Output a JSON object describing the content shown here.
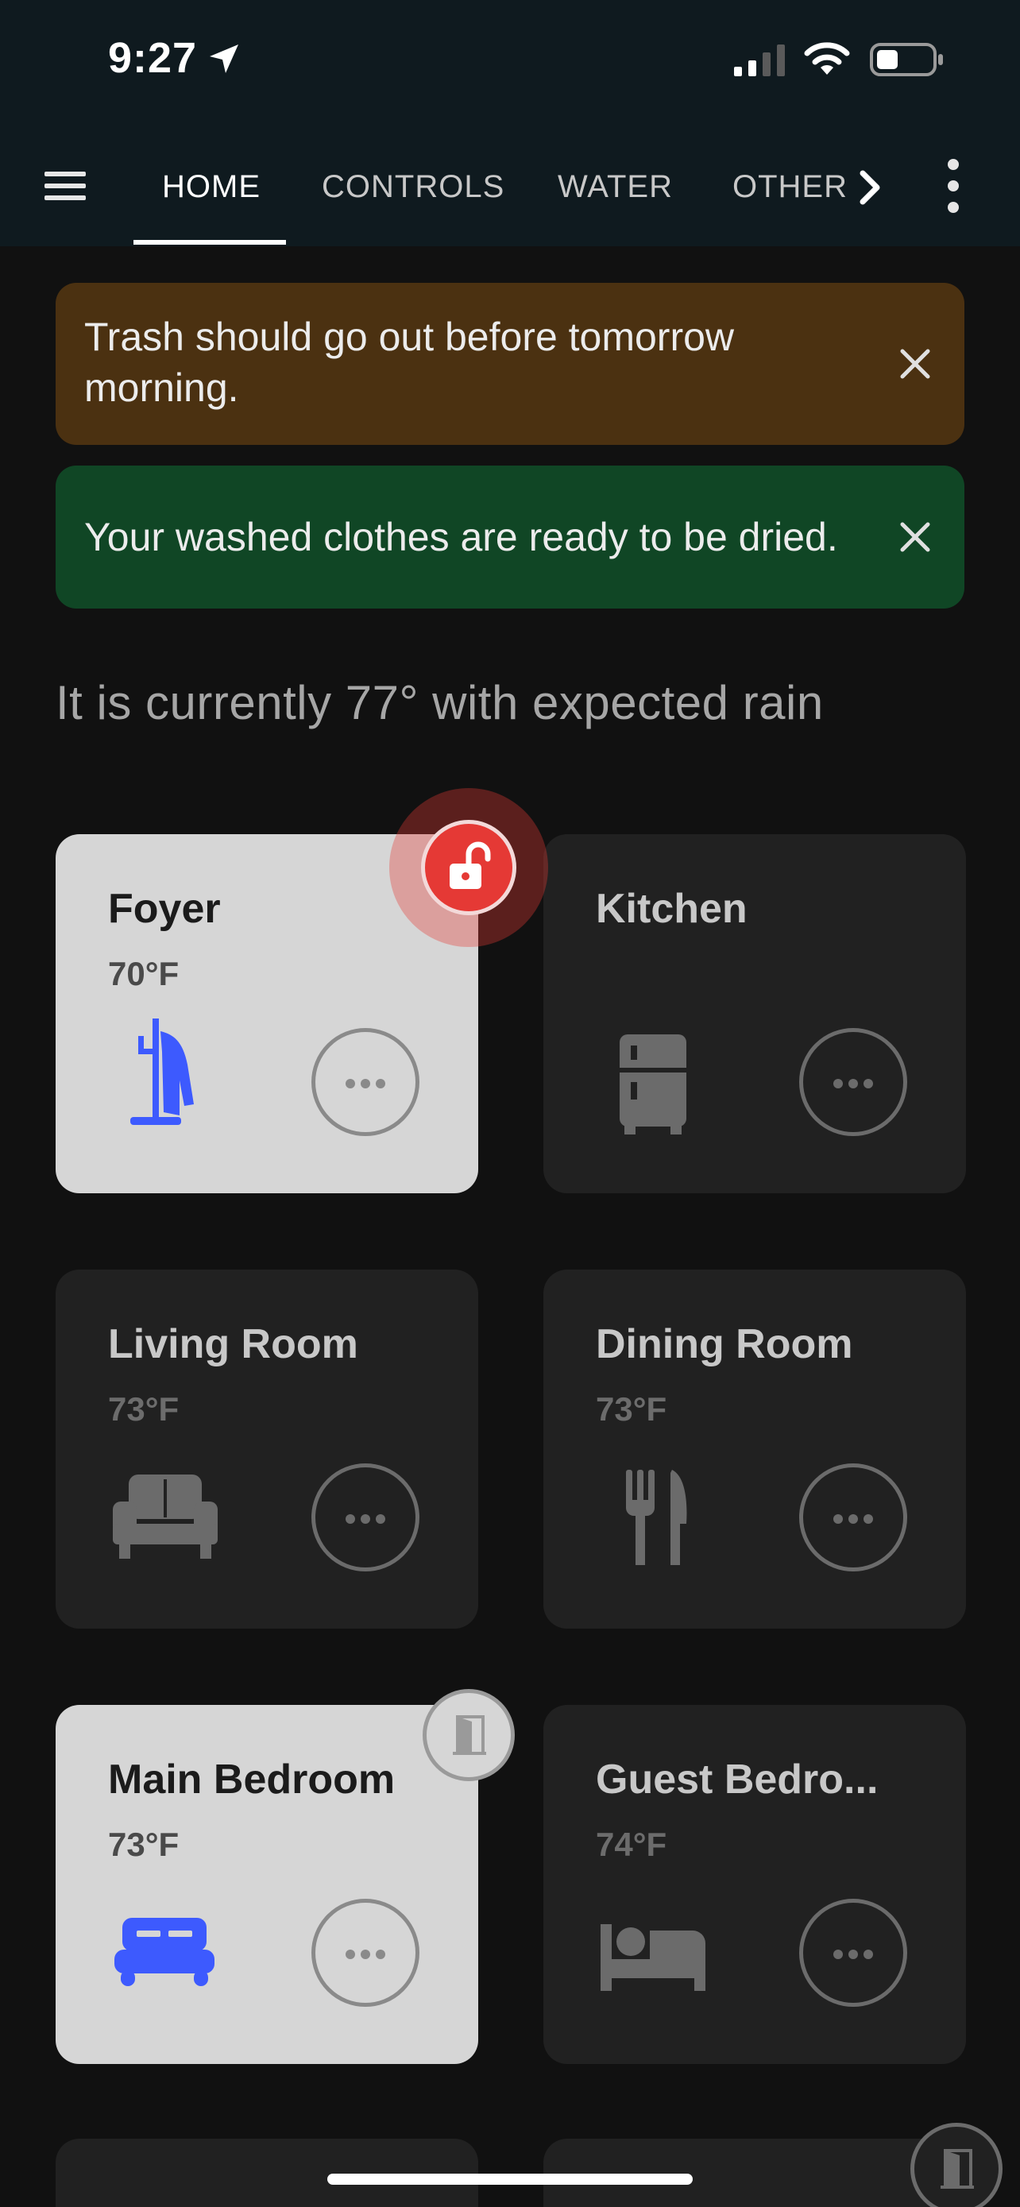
{
  "status_bar": {
    "time": "9:27"
  },
  "nav": {
    "tabs": [
      {
        "label": "HOME",
        "active": true
      },
      {
        "label": "CONTROLS",
        "active": false
      },
      {
        "label": "WATER",
        "active": false
      },
      {
        "label": "OTHER",
        "active": false
      }
    ]
  },
  "notifications": [
    {
      "text": "Trash should go out before tomorrow morning.",
      "color": "#4b3111"
    },
    {
      "text": "Your washed clothes are ready to be dried.",
      "color": "#104625"
    }
  ],
  "weather": {
    "text": "It is currently 77° with expected rain"
  },
  "rooms": [
    {
      "name": "Foyer",
      "temp": "70°F",
      "icon": "coat-rack-icon",
      "active": true
    },
    {
      "name": "Kitchen",
      "temp": "",
      "icon": "fridge-icon",
      "active": false
    },
    {
      "name": "Living Room",
      "temp": "73°F",
      "icon": "sofa-icon",
      "active": false
    },
    {
      "name": "Dining Room",
      "temp": "73°F",
      "icon": "silverware-icon",
      "active": false
    },
    {
      "name": "Main Bedroom",
      "temp": "73°F",
      "icon": "bed-icon",
      "active": true
    },
    {
      "name": "Guest Bedro...",
      "temp": "74°F",
      "icon": "bed-icon",
      "active": false
    }
  ],
  "colors": {
    "accent_blue": "#3d5afe",
    "lock_red": "#e53935",
    "card_on": "#d6d6d6",
    "card_off": "#212121"
  }
}
